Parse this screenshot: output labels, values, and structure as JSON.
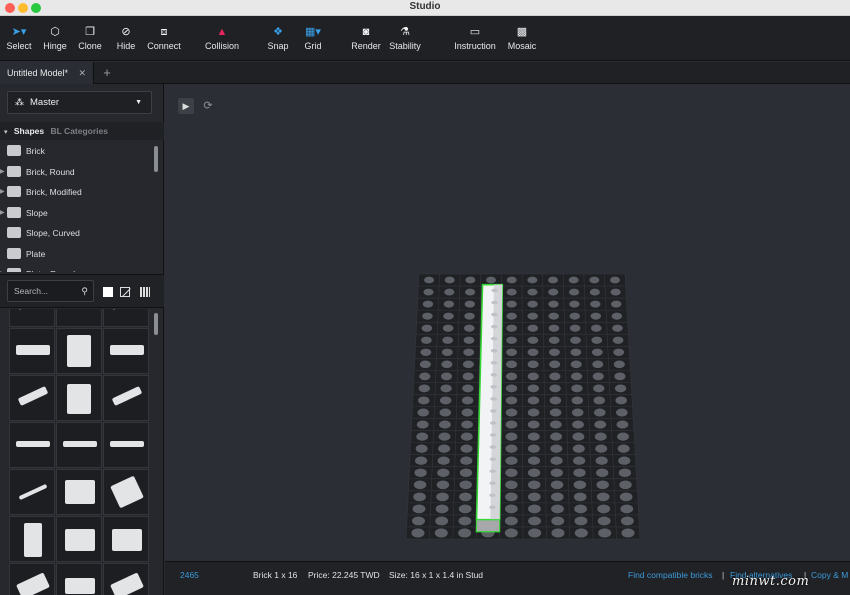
{
  "window": {
    "title": "Studio"
  },
  "toolbar": {
    "items": [
      {
        "label": "Select",
        "icon": "select-arrow-icon",
        "glyph": "➤▾"
      },
      {
        "label": "Hinge",
        "icon": "hinge-icon",
        "glyph": "⬡"
      },
      {
        "label": "Clone",
        "icon": "clone-icon",
        "glyph": "❐"
      },
      {
        "label": "Hide",
        "icon": "hide-eye-icon",
        "glyph": "⊘"
      },
      {
        "label": "Connect",
        "icon": "connect-icon",
        "glyph": "⧈"
      },
      {
        "label": "Collision",
        "icon": "collision-warning-icon",
        "glyph": "▲"
      },
      {
        "label": "Snap",
        "icon": "snap-icon",
        "glyph": "❖"
      },
      {
        "label": "Grid",
        "icon": "grid-icon",
        "glyph": "▦▾"
      },
      {
        "label": "Render",
        "icon": "camera-icon",
        "glyph": "◙"
      },
      {
        "label": "Stability",
        "icon": "stability-icon",
        "glyph": "⚗"
      },
      {
        "label": "Instruction",
        "icon": "instruction-book-icon",
        "glyph": "▭"
      },
      {
        "label": "Mosaic",
        "icon": "mosaic-icon",
        "glyph": "▩"
      }
    ]
  },
  "tabs": {
    "active_label": "Untitled Model*",
    "close_glyph": "✕",
    "add_glyph": "+"
  },
  "palette": {
    "selector_label": "Master",
    "selector_icon": "palette-icon",
    "shapes_tab": "Shapes",
    "bl_tab": "BL Categories",
    "categories": [
      {
        "label": "Brick",
        "expandable": false
      },
      {
        "label": "Brick, Round",
        "expandable": true
      },
      {
        "label": "Brick, Modified",
        "expandable": true
      },
      {
        "label": "Slope",
        "expandable": true
      },
      {
        "label": "Slope, Curved",
        "expandable": false
      },
      {
        "label": "Plate",
        "expandable": false
      },
      {
        "label": "Plate, Round",
        "expandable": true
      }
    ],
    "search_placeholder": "Search..."
  },
  "status": {
    "part_id": "2465",
    "part_name": "Brick 1 x 16",
    "price": "Price: 22.245 TWD",
    "size": "Size: 16 x 1 x 1.4 in Stud",
    "link_compatible": "Find compatible bricks",
    "separator": "|",
    "link_alternatives": "Find alternatives",
    "link_copy": "Copy & M"
  },
  "watermark": "minwt.com",
  "colors": {
    "accent": "#3aa0e8",
    "collision": "#e3265b",
    "selection": "#36d636",
    "background": "#2b2e35"
  }
}
